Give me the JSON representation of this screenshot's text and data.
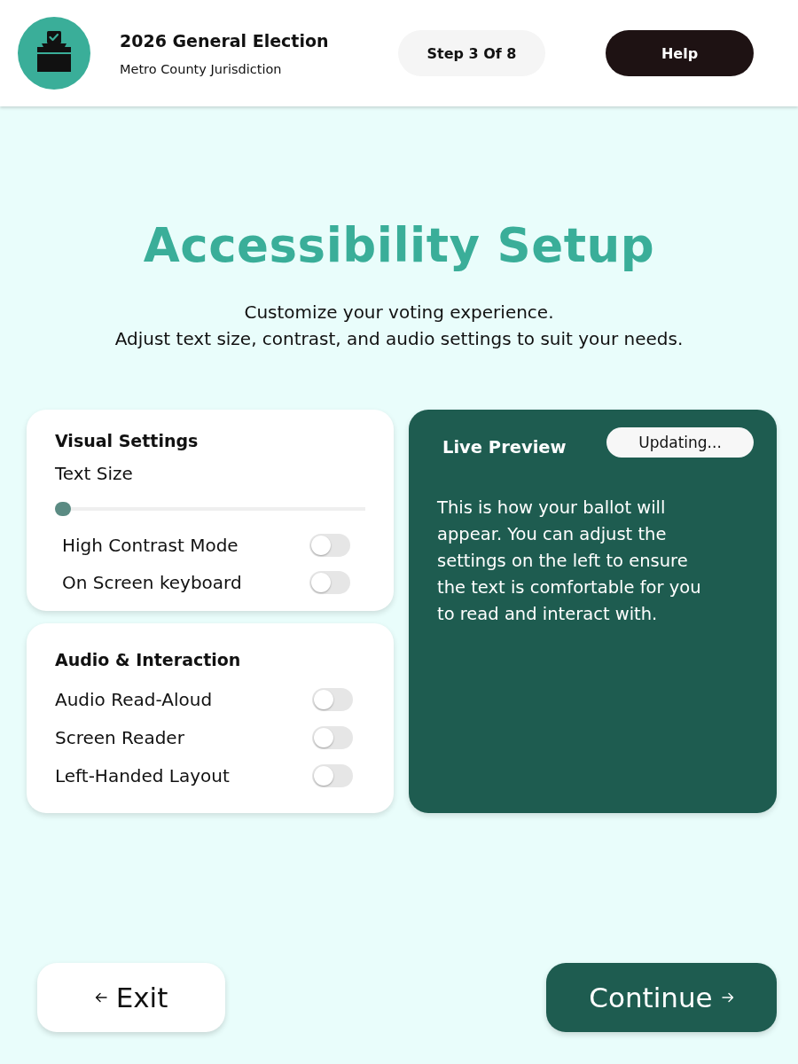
{
  "header": {
    "title": "2026 General Election",
    "subtitle": "Metro County Jurisdiction",
    "step": "Step 3 Of 8",
    "help_button": "Help"
  },
  "intro": {
    "title": "Accessibility Setup",
    "lines": [
      "Customize your voting experience.",
      "Adjust text size, contrast, and audio settings to suit your needs."
    ]
  },
  "visual_settings": {
    "title": "Visual Settings",
    "items": [
      {
        "kind": "slider",
        "label": "Text Size",
        "level": 0
      },
      {
        "kind": "toggle",
        "label": "High Contrast Mode",
        "on": false
      },
      {
        "kind": "toggle",
        "label": "On Screen keyboard",
        "on": false
      }
    ]
  },
  "audio_settings": {
    "title": "Audio & Interaction",
    "items": [
      {
        "kind": "toggle",
        "label": "Audio Read-Aloud",
        "on": false
      },
      {
        "kind": "toggle",
        "label": "Screen Reader",
        "on": false
      },
      {
        "kind": "toggle",
        "label": "Left-Handed Layout",
        "on": false
      }
    ]
  },
  "preview": {
    "title": "Live Preview",
    "status": "Updating...",
    "text": "This is how your ballot will appear. You can adjust the settings on the left to ensure the text is comfortable for you to read and interact with."
  },
  "footer": {
    "back_button": "Exit",
    "continue_button": "Continue"
  }
}
